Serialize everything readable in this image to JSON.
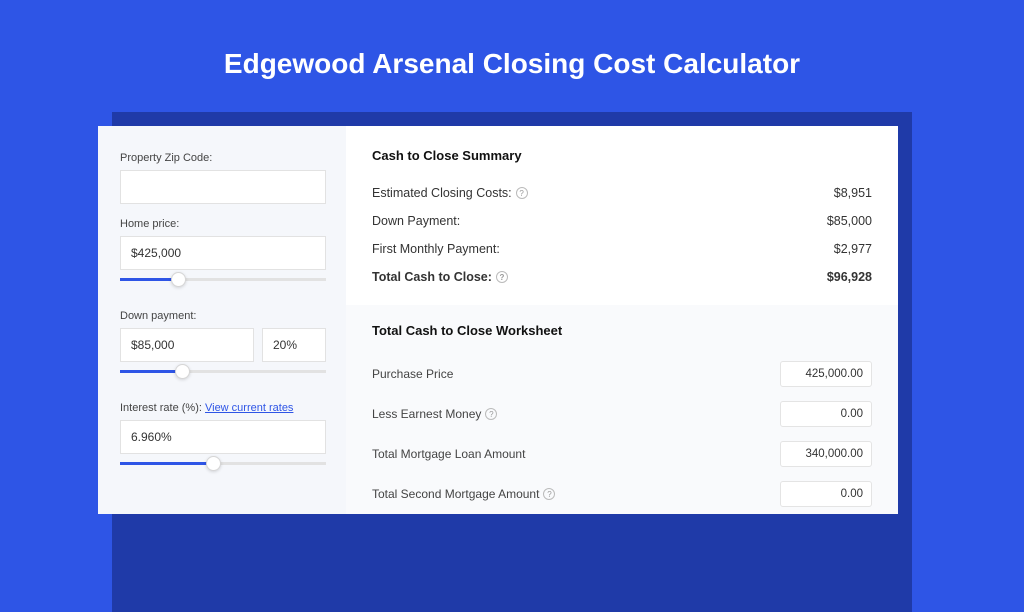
{
  "title": "Edgewood Arsenal Closing Cost Calculator",
  "sidebar": {
    "zip_label": "Property Zip Code:",
    "zip_value": "",
    "home_price_label": "Home price:",
    "home_price_value": "$425,000",
    "down_payment_label": "Down payment:",
    "down_payment_value": "$85,000",
    "down_payment_pct": "20%",
    "interest_label": "Interest rate (%):",
    "interest_link": "View current rates",
    "interest_value": "6.960%"
  },
  "summary": {
    "title": "Cash to Close Summary",
    "rows": [
      {
        "label": "Estimated Closing Costs:",
        "help": true,
        "value": "$8,951"
      },
      {
        "label": "Down Payment:",
        "help": false,
        "value": "$85,000"
      },
      {
        "label": "First Monthly Payment:",
        "help": false,
        "value": "$2,977"
      }
    ],
    "total_label": "Total Cash to Close:",
    "total_value": "$96,928"
  },
  "worksheet": {
    "title": "Total Cash to Close Worksheet",
    "rows": [
      {
        "label": "Purchase Price",
        "help": false,
        "value": "425,000.00"
      },
      {
        "label": "Less Earnest Money",
        "help": true,
        "value": "0.00"
      },
      {
        "label": "Total Mortgage Loan Amount",
        "help": false,
        "value": "340,000.00"
      },
      {
        "label": "Total Second Mortgage Amount",
        "help": true,
        "value": "0.00"
      }
    ]
  },
  "slider": {
    "home_price_pct": 28,
    "down_payment_pct": 30,
    "interest_pct": 45
  }
}
